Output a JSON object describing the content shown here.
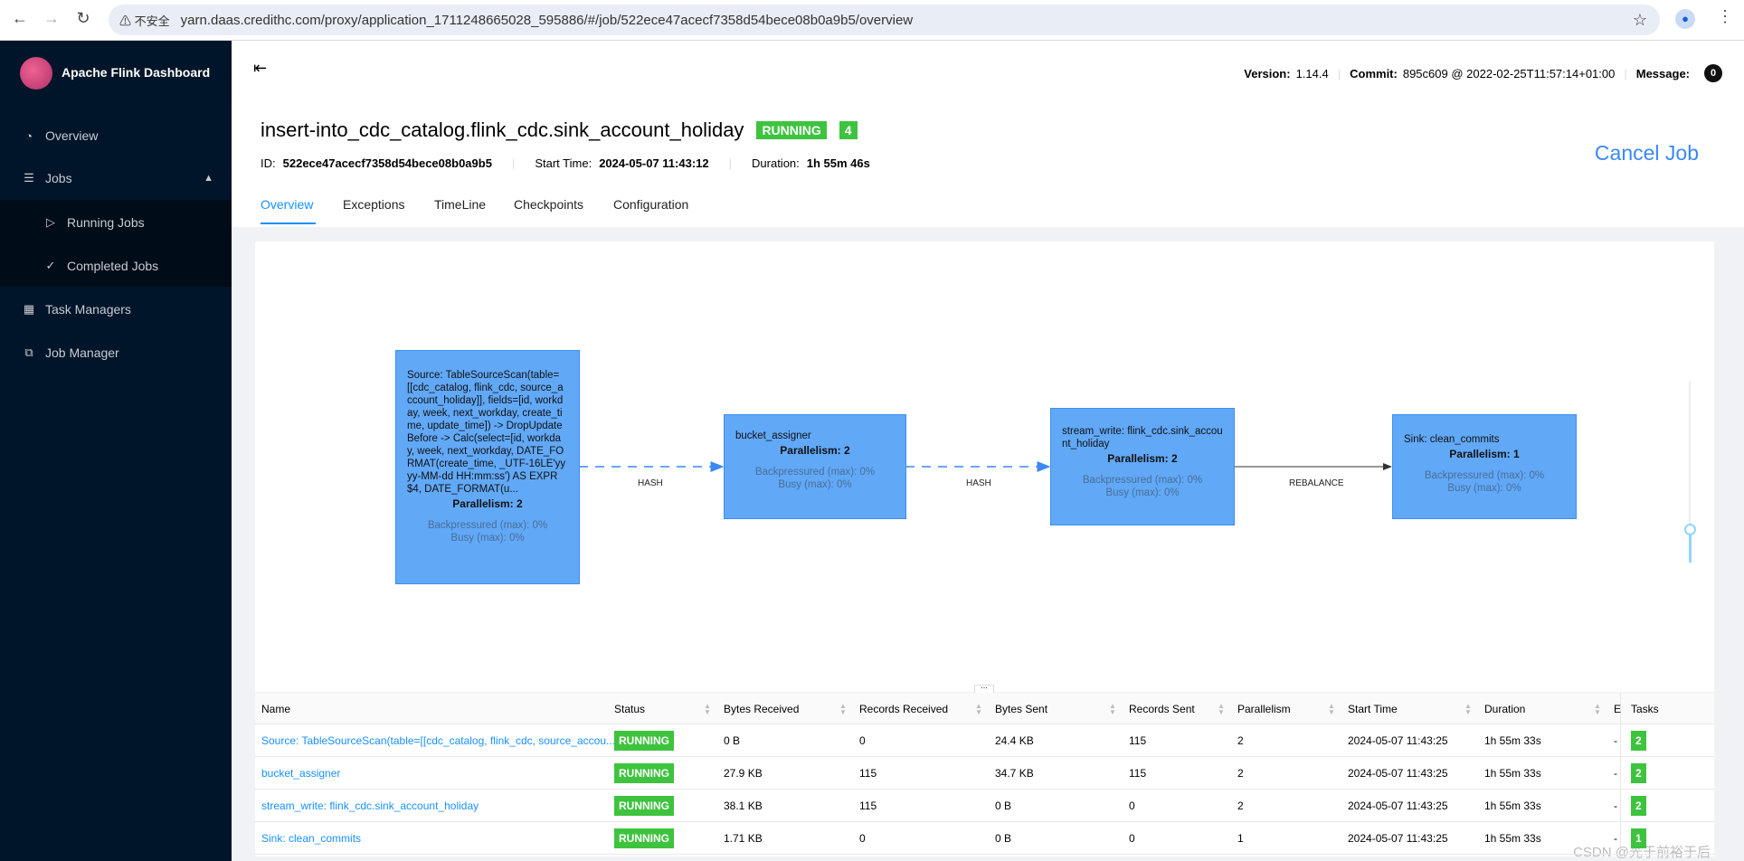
{
  "browser": {
    "security": "不安全",
    "url": "yarn.daas.credithc.com/proxy/application_1711248665028_595886/#/job/522ece47acecf7358d54bece08b0a9b5/overview"
  },
  "sidebar": {
    "brand": "Apache Flink Dashboard",
    "items": [
      {
        "label": "Overview"
      },
      {
        "label": "Jobs"
      },
      {
        "label": "Running Jobs"
      },
      {
        "label": "Completed Jobs"
      },
      {
        "label": "Task Managers"
      },
      {
        "label": "Job Manager"
      }
    ]
  },
  "header": {
    "version_label": "Version:",
    "version": "1.14.4",
    "commit_label": "Commit:",
    "commit": "895c609 @ 2022-02-25T11:57:14+01:00",
    "message_label": "Message:",
    "message_count": "0"
  },
  "job": {
    "name": "insert-into_cdc_catalog.flink_cdc.sink_account_holiday",
    "status": "RUNNING",
    "tasks": "4",
    "id_label": "ID:",
    "id": "522ece47acecf7358d54bece08b0a9b5",
    "start_label": "Start Time:",
    "start": "2024-05-07 11:43:12",
    "duration_label": "Duration:",
    "duration": "1h 55m 46s",
    "cancel": "Cancel Job",
    "status_color": "#3ec33e"
  },
  "tabs": [
    {
      "label": "Overview",
      "active": true
    },
    {
      "label": "Exceptions"
    },
    {
      "label": "TimeLine"
    },
    {
      "label": "Checkpoints"
    },
    {
      "label": "Configuration"
    }
  ],
  "graph": {
    "nodes": [
      {
        "name": "Source: TableSourceScan(table=[[cdc_catalog, flink_cdc, source_account_holiday]], fields=[id, workday, week, next_workday, create_time, update_time]) -> DropUpdateBefore -> Calc(select=[id, workday, week, next_workday, DATE_FORMAT(create_time, _UTF-16LE'yyyy-MM-dd HH:mm:ss') AS EXPR$4, DATE_FORMAT(u...",
        "parallelism": "Parallelism: 2",
        "backpressure": "Backpressured (max): 0%",
        "busy": "Busy (max): 0%"
      },
      {
        "name": "bucket_assigner",
        "parallelism": "Parallelism: 2",
        "backpressure": "Backpressured (max): 0%",
        "busy": "Busy (max): 0%"
      },
      {
        "name": "stream_write: flink_cdc.sink_account_holiday",
        "parallelism": "Parallelism: 2",
        "backpressure": "Backpressured (max): 0%",
        "busy": "Busy (max): 0%"
      },
      {
        "name": "Sink: clean_commits",
        "parallelism": "Parallelism: 1",
        "backpressure": "Backpressured (max): 0%",
        "busy": "Busy (max): 0%"
      }
    ],
    "edges": [
      {
        "label": "HASH"
      },
      {
        "label": "HASH"
      },
      {
        "label": "REBALANCE"
      }
    ]
  },
  "table": {
    "columns": [
      "Name",
      "Status",
      "Bytes Received",
      "Records Received",
      "Bytes Sent",
      "Records Sent",
      "Parallelism",
      "Start Time",
      "Duration",
      "E",
      "Tasks"
    ],
    "rows": [
      {
        "name": "Source: TableSourceScan(table=[[cdc_catalog, flink_cdc, source_accou...",
        "status": "RUNNING",
        "bytes_received": "0 B",
        "records_received": "0",
        "bytes_sent": "24.4 KB",
        "records_sent": "115",
        "parallelism": "2",
        "start_time": "2024-05-07 11:43:25",
        "duration": "1h 55m 33s",
        "e": "-",
        "tasks": "2"
      },
      {
        "name": "bucket_assigner",
        "status": "RUNNING",
        "bytes_received": "27.9 KB",
        "records_received": "115",
        "bytes_sent": "34.7 KB",
        "records_sent": "115",
        "parallelism": "2",
        "start_time": "2024-05-07 11:43:25",
        "duration": "1h 55m 33s",
        "e": "-",
        "tasks": "2"
      },
      {
        "name": "stream_write: flink_cdc.sink_account_holiday",
        "status": "RUNNING",
        "bytes_received": "38.1 KB",
        "records_received": "115",
        "bytes_sent": "0 B",
        "records_sent": "0",
        "parallelism": "2",
        "start_time": "2024-05-07 11:43:25",
        "duration": "1h 55m 33s",
        "e": "-",
        "tasks": "2"
      },
      {
        "name": "Sink: clean_commits",
        "status": "RUNNING",
        "bytes_received": "1.71 KB",
        "records_received": "0",
        "bytes_sent": "0 B",
        "records_sent": "0",
        "parallelism": "1",
        "start_time": "2024-05-07 11:43:25",
        "duration": "1h 55m 33s",
        "e": "-",
        "tasks": "1"
      }
    ]
  },
  "watermark": "CSDN @光于前裕于后"
}
